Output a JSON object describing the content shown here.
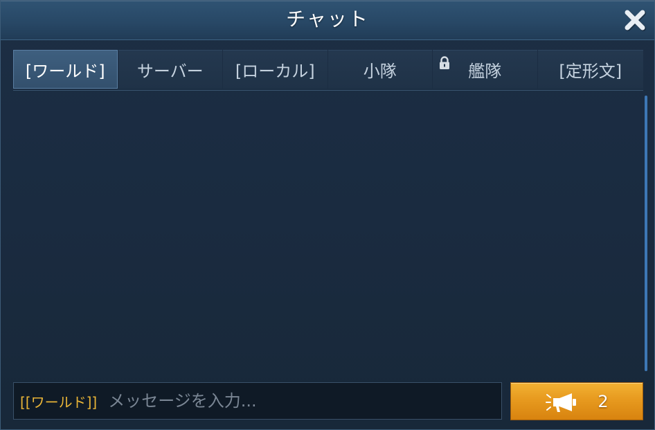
{
  "window": {
    "title": "チャット"
  },
  "tabs": [
    {
      "label": "[ワールド]",
      "active": true,
      "locked": false
    },
    {
      "label": "サーバー",
      "active": false,
      "locked": false
    },
    {
      "label": "[ローカル]",
      "active": false,
      "locked": false
    },
    {
      "label": "小隊",
      "active": false,
      "locked": false
    },
    {
      "label": "艦隊",
      "active": false,
      "locked": true
    },
    {
      "label": "[定形文]",
      "active": false,
      "locked": false
    }
  ],
  "input": {
    "channel_prefix": "[[ワールド]]",
    "placeholder": "メッセージを入力...",
    "value": ""
  },
  "send_button": {
    "count": "2",
    "icon": "megaphone-icon"
  },
  "colors": {
    "accent_gold": "#e8b437",
    "send_orange": "#e79a1f",
    "active_tab": "#3e5f7f",
    "scrollbar": "#3d77b5"
  }
}
